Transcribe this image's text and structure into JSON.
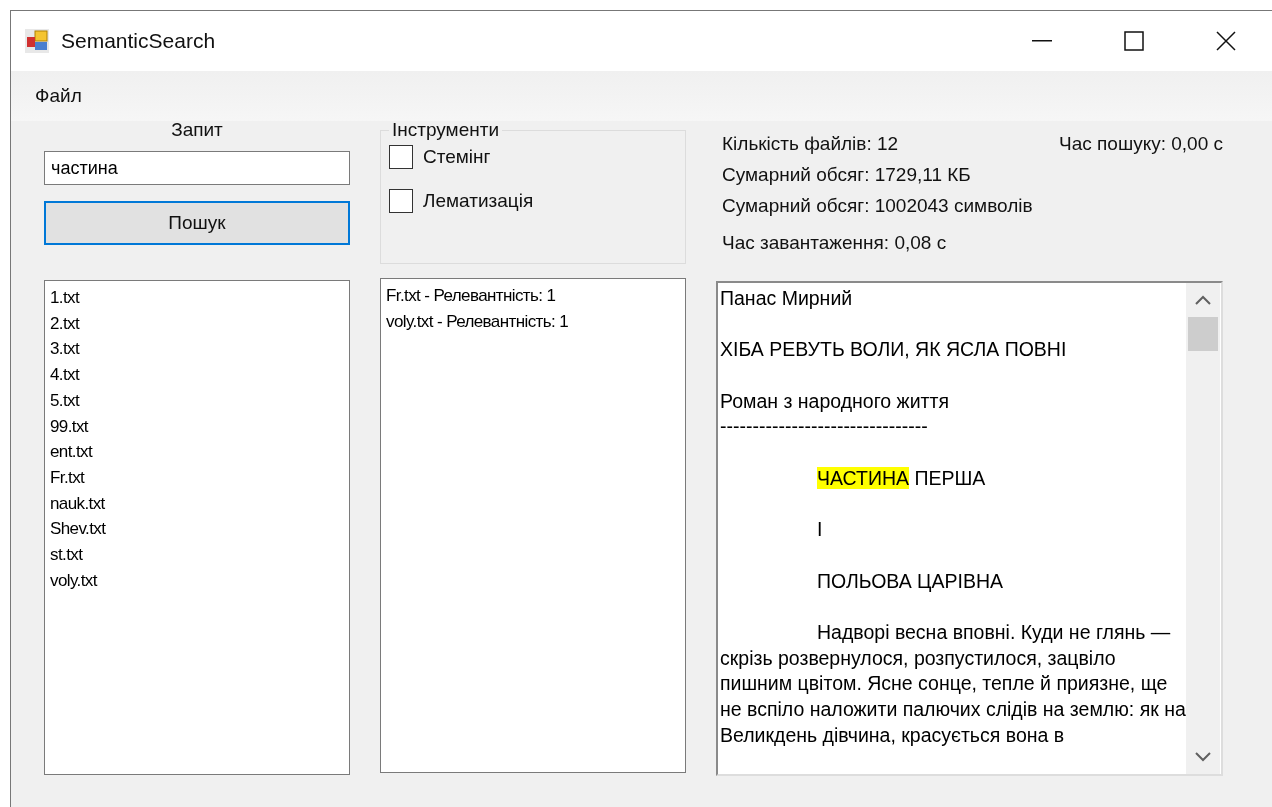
{
  "window": {
    "title": "SemanticSearch"
  },
  "menu": [
    {
      "label": "Файл"
    }
  ],
  "query": {
    "label": "Запит",
    "value": "частина",
    "button": "Пошук"
  },
  "tools": {
    "title": "Інструменти",
    "options": [
      {
        "label": "Стемінг",
        "checked": false
      },
      {
        "label": "Лематизація",
        "checked": false
      }
    ]
  },
  "stats": {
    "file_count": "Кількість файлів: 12",
    "search_time": "Час пошуку: 0,00 с",
    "size_kb": "Сумарний обсяг: 1729,11 КБ",
    "size_chars": "Сумарний обсяг: 1002043 символів",
    "load_time": "Час завантаження: 0,08 с"
  },
  "files": [
    "1.txt",
    "2.txt",
    "3.txt",
    "4.txt",
    "5.txt",
    "99.txt",
    "ent.txt",
    "Fr.txt",
    "nauk.txt",
    "Shev.txt",
    "st.txt",
    "voly.txt"
  ],
  "results": [
    "Fr.txt - Релевантність: 1",
    "voly.txt - Релевантність: 1"
  ],
  "document": {
    "lines": [
      {
        "parts": [
          {
            "text": "Панас Мирний",
            "highlighted": false
          }
        ],
        "indented": false,
        "blank_before": false
      },
      {
        "parts": [
          {
            "text": "ХІБА РЕВУТЬ ВОЛИ, ЯК ЯСЛА ПОВНІ",
            "highlighted": false
          }
        ],
        "indented": false,
        "blank_before": true
      },
      {
        "parts": [
          {
            "text": "Роман з народного життя",
            "highlighted": false
          }
        ],
        "indented": false,
        "blank_before": true
      },
      {
        "parts": [
          {
            "text": "--------------------------------",
            "highlighted": false
          }
        ],
        "indented": false,
        "blank_before": false
      },
      {
        "parts": [
          {
            "text": "ЧАСТИНА",
            "highlighted": true
          },
          {
            "text": " ПЕРША",
            "highlighted": false
          }
        ],
        "indented": true,
        "blank_before": true
      },
      {
        "parts": [
          {
            "text": "І",
            "highlighted": false
          }
        ],
        "indented": true,
        "blank_before": true
      },
      {
        "parts": [
          {
            "text": "ПОЛЬОВА ЦАРІВНА",
            "highlighted": false
          }
        ],
        "indented": true,
        "blank_before": true
      },
      {
        "parts": [
          {
            "text": "Надворі весна вповні. Куди не глянь — скрізь розвернулося, розпустилося, зацвіло пишним цвітом. Ясне сонце, тепле й приязне, ще не вспіло наложити палючих слідів на землю: як на Великдень дівчина, красується вона в",
            "highlighted": false
          }
        ],
        "indented": true,
        "blank_before": true
      }
    ]
  }
}
